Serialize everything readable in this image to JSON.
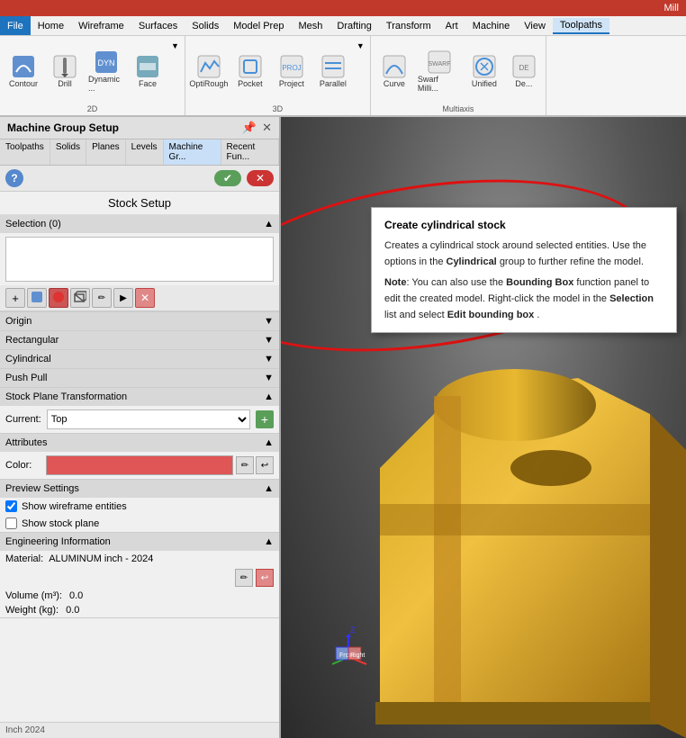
{
  "mill_label": "Mill",
  "menu": {
    "items": [
      "File",
      "Home",
      "Wireframe",
      "Surfaces",
      "Solids",
      "Model Prep",
      "Mesh",
      "Drafting",
      "Transform",
      "Art",
      "Machine",
      "View",
      "Toolpaths"
    ],
    "active": "Toolpaths"
  },
  "ribbon": {
    "groups": [
      {
        "title": "2D",
        "buttons": [
          {
            "label": "Contour",
            "icon": "contour"
          },
          {
            "label": "Drill",
            "icon": "drill"
          },
          {
            "label": "Dynamic ...",
            "icon": "dynamic"
          },
          {
            "label": "Face",
            "icon": "face"
          },
          {
            "label": "▼",
            "icon": "dropdown"
          }
        ]
      },
      {
        "title": "3D",
        "buttons": [
          {
            "label": "OptiRough",
            "icon": "optirough"
          },
          {
            "label": "Pocket",
            "icon": "pocket"
          },
          {
            "label": "Project",
            "icon": "project"
          },
          {
            "label": "Parallel",
            "icon": "parallel"
          },
          {
            "label": "▼",
            "icon": "dropdown"
          }
        ]
      },
      {
        "title": "Multiaxis",
        "buttons": [
          {
            "label": "Curve",
            "icon": "curve"
          },
          {
            "label": "Swarf Milli...",
            "icon": "swarf"
          },
          {
            "label": "Unified",
            "icon": "unified"
          },
          {
            "label": "De...",
            "icon": "de"
          }
        ]
      }
    ]
  },
  "left_panel": {
    "title": "Machine Group Setup",
    "pin_label": "🖈",
    "close_label": "✕",
    "tabs": [
      "Toolpaths",
      "Solids",
      "Planes",
      "Levels",
      "Machine Gr...",
      "Recent Fun..."
    ],
    "ok_label": "✔",
    "cancel_label": "✕",
    "setup_title": "Stock Setup",
    "selection_section": "Selection (0)",
    "toolbar_buttons": [
      "+",
      "🔷",
      "🔴",
      "📦",
      "✏️",
      "▶",
      "✕"
    ],
    "sections": [
      {
        "label": "Origin",
        "expanded": false
      },
      {
        "label": "Rectangular",
        "expanded": false
      },
      {
        "label": "Cylindrical",
        "expanded": false
      },
      {
        "label": "Push Pull",
        "expanded": false
      },
      {
        "label": "Stock Plane Transformation",
        "expanded": true
      },
      {
        "label": "Attributes",
        "expanded": true
      },
      {
        "label": "Preview Settings",
        "expanded": true
      },
      {
        "label": "Engineering Information",
        "expanded": true
      }
    ],
    "stock_plane": {
      "label": "Current:",
      "value": "Top"
    },
    "color_label": "Color:",
    "preview": {
      "show_wireframe": true,
      "show_stock": false,
      "wireframe_label": "Show wireframe entities",
      "stock_label": "Show stock plane"
    },
    "engineering": {
      "material_label": "Material:",
      "material_value": "ALUMINUM inch - 2024",
      "volume_label": "Volume (m³):",
      "volume_value": "0.0",
      "weight_label": "Weight (kg):",
      "weight_value": "0.0"
    }
  },
  "tooltip": {
    "title": "Create cylindrical stock",
    "body_1": "Creates a cylindrical stock around selected entities. Use the options in the",
    "body_bold_1": "Cylindrical",
    "body_2": "group to further refine the model.",
    "note_label": "Note",
    "note_body": ": You can also use the",
    "note_bold_1": "Bounding Box",
    "note_body_2": "function panel to edit the created model. Right-click the model in the",
    "note_bold_2": "Selection",
    "note_body_3": "list and select",
    "note_bold_3": "Edit bounding box",
    "note_end": "."
  },
  "axis_labels": [
    "Z",
    "Front",
    "Right"
  ],
  "bottom_note": "Inch 2024"
}
